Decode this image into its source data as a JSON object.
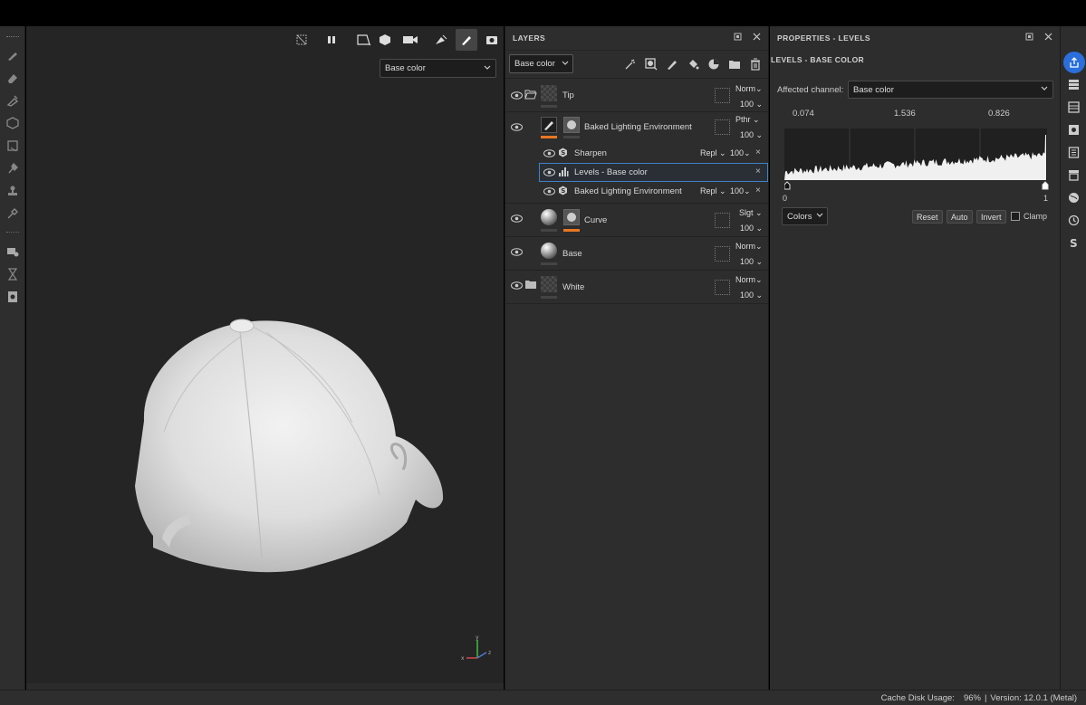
{
  "viewport": {
    "channel_select": "Base color"
  },
  "layers_panel": {
    "title": "LAYERS",
    "channel_select": "Base color",
    "layers": [
      {
        "name": "Tip",
        "blend": "Norm",
        "opacity": "100"
      },
      {
        "name": "Baked Lighting Environment",
        "blend": "Pthr",
        "opacity": "100",
        "effects": [
          {
            "name": "Sharpen",
            "blend": "Repl",
            "opacity": "100"
          },
          {
            "name": "Levels - Base color"
          },
          {
            "name": "Baked Lighting Environment",
            "blend": "Repl",
            "opacity": "100"
          }
        ]
      },
      {
        "name": "Curve",
        "blend": "Slgt",
        "opacity": "100"
      },
      {
        "name": "Base",
        "blend": "Norm",
        "opacity": "100"
      },
      {
        "name": "White",
        "blend": "Norm",
        "opacity": "100"
      }
    ]
  },
  "properties_panel": {
    "title": "PROPERTIES - LEVELS",
    "subtitle": "LEVELS - BASE COLOR",
    "affected_channel_label": "Affected channel:",
    "affected_channel_value": "Base color",
    "histogram": {
      "input_low": "0.074",
      "gamma": "1.536",
      "input_high": "0.826",
      "min_label": "0",
      "max_label": "1"
    },
    "mode_select": "Colors",
    "buttons": {
      "reset": "Reset",
      "auto": "Auto",
      "invert": "Invert"
    },
    "clamp_label": "Clamp"
  },
  "statusbar": {
    "cache_label": "Cache Disk Usage:",
    "cache_value": "96%",
    "separator": "|",
    "version": "Version: 12.0.1 (Metal)"
  },
  "colors": {
    "accent_blue": "#2a6fdb",
    "selection_outline": "#3e82c5",
    "orange_mask": "#e87722"
  }
}
